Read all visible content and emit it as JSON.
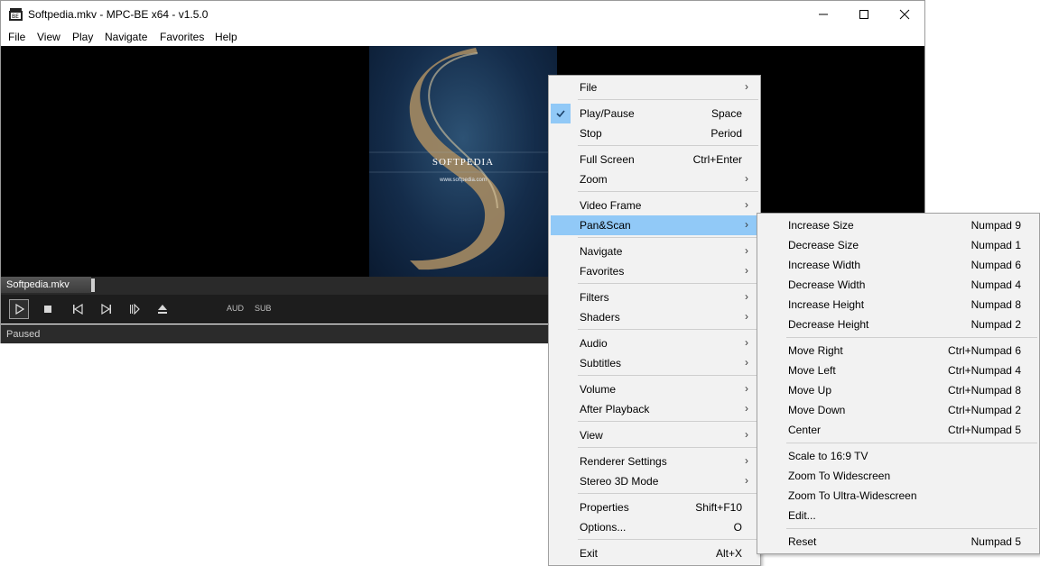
{
  "window": {
    "title": "Softpedia.mkv - MPC-BE x64 - v1.5.0",
    "menubar": [
      "File",
      "View",
      "Play",
      "Navigate",
      "Favorites",
      "Help"
    ]
  },
  "player": {
    "cover_text": "SOFTPEDIA",
    "cover_url": "www.softpedia.com",
    "filename": "Softpedia.mkv",
    "aud_label": "AUD",
    "sub_label": "SUB",
    "status": "Paused"
  },
  "context_menu": {
    "items": [
      {
        "label": "File",
        "shortcut": "",
        "arrow": true
      },
      {
        "label": "Play/Pause",
        "shortcut": "Space",
        "arrow": false,
        "checked": true
      },
      {
        "label": "Stop",
        "shortcut": "Period",
        "arrow": false
      },
      {
        "label": "Full Screen",
        "shortcut": "Ctrl+Enter",
        "arrow": false
      },
      {
        "label": "Zoom",
        "shortcut": "",
        "arrow": true
      },
      {
        "label": "Video Frame",
        "shortcut": "",
        "arrow": true
      },
      {
        "label": "Pan&Scan",
        "shortcut": "",
        "arrow": true,
        "highlighted": true
      },
      {
        "label": "Navigate",
        "shortcut": "",
        "arrow": true
      },
      {
        "label": "Favorites",
        "shortcut": "",
        "arrow": true
      },
      {
        "label": "Filters",
        "shortcut": "",
        "arrow": true
      },
      {
        "label": "Shaders",
        "shortcut": "",
        "arrow": true
      },
      {
        "label": "Audio",
        "shortcut": "",
        "arrow": true
      },
      {
        "label": "Subtitles",
        "shortcut": "",
        "arrow": true
      },
      {
        "label": "Volume",
        "shortcut": "",
        "arrow": true
      },
      {
        "label": "After Playback",
        "shortcut": "",
        "arrow": true
      },
      {
        "label": "View",
        "shortcut": "",
        "arrow": true
      },
      {
        "label": "Renderer Settings",
        "shortcut": "",
        "arrow": true
      },
      {
        "label": "Stereo 3D Mode",
        "shortcut": "",
        "arrow": true
      },
      {
        "label": "Properties",
        "shortcut": "Shift+F10",
        "arrow": false
      },
      {
        "label": "Options...",
        "shortcut": "O",
        "arrow": false
      },
      {
        "label": "Exit",
        "shortcut": "Alt+X",
        "arrow": false
      }
    ]
  },
  "submenu": {
    "items": [
      {
        "label": "Increase Size",
        "shortcut": "Numpad 9"
      },
      {
        "label": "Decrease Size",
        "shortcut": "Numpad 1"
      },
      {
        "label": "Increase Width",
        "shortcut": "Numpad 6"
      },
      {
        "label": "Decrease Width",
        "shortcut": "Numpad 4"
      },
      {
        "label": "Increase Height",
        "shortcut": "Numpad 8"
      },
      {
        "label": "Decrease Height",
        "shortcut": "Numpad 2"
      },
      {
        "label": "Move Right",
        "shortcut": "Ctrl+Numpad 6"
      },
      {
        "label": "Move Left",
        "shortcut": "Ctrl+Numpad 4"
      },
      {
        "label": "Move Up",
        "shortcut": "Ctrl+Numpad 8"
      },
      {
        "label": "Move Down",
        "shortcut": "Ctrl+Numpad 2"
      },
      {
        "label": "Center",
        "shortcut": "Ctrl+Numpad 5"
      },
      {
        "label": "Scale to 16:9 TV",
        "shortcut": ""
      },
      {
        "label": "Zoom To Widescreen",
        "shortcut": ""
      },
      {
        "label": "Zoom To Ultra-Widescreen",
        "shortcut": ""
      },
      {
        "label": "Edit...",
        "shortcut": ""
      },
      {
        "label": "Reset",
        "shortcut": "Numpad 5"
      }
    ]
  },
  "colors": {
    "highlight": "#91c9f7",
    "menu_bg": "#f2f2f2",
    "player_bg": "#000000"
  }
}
